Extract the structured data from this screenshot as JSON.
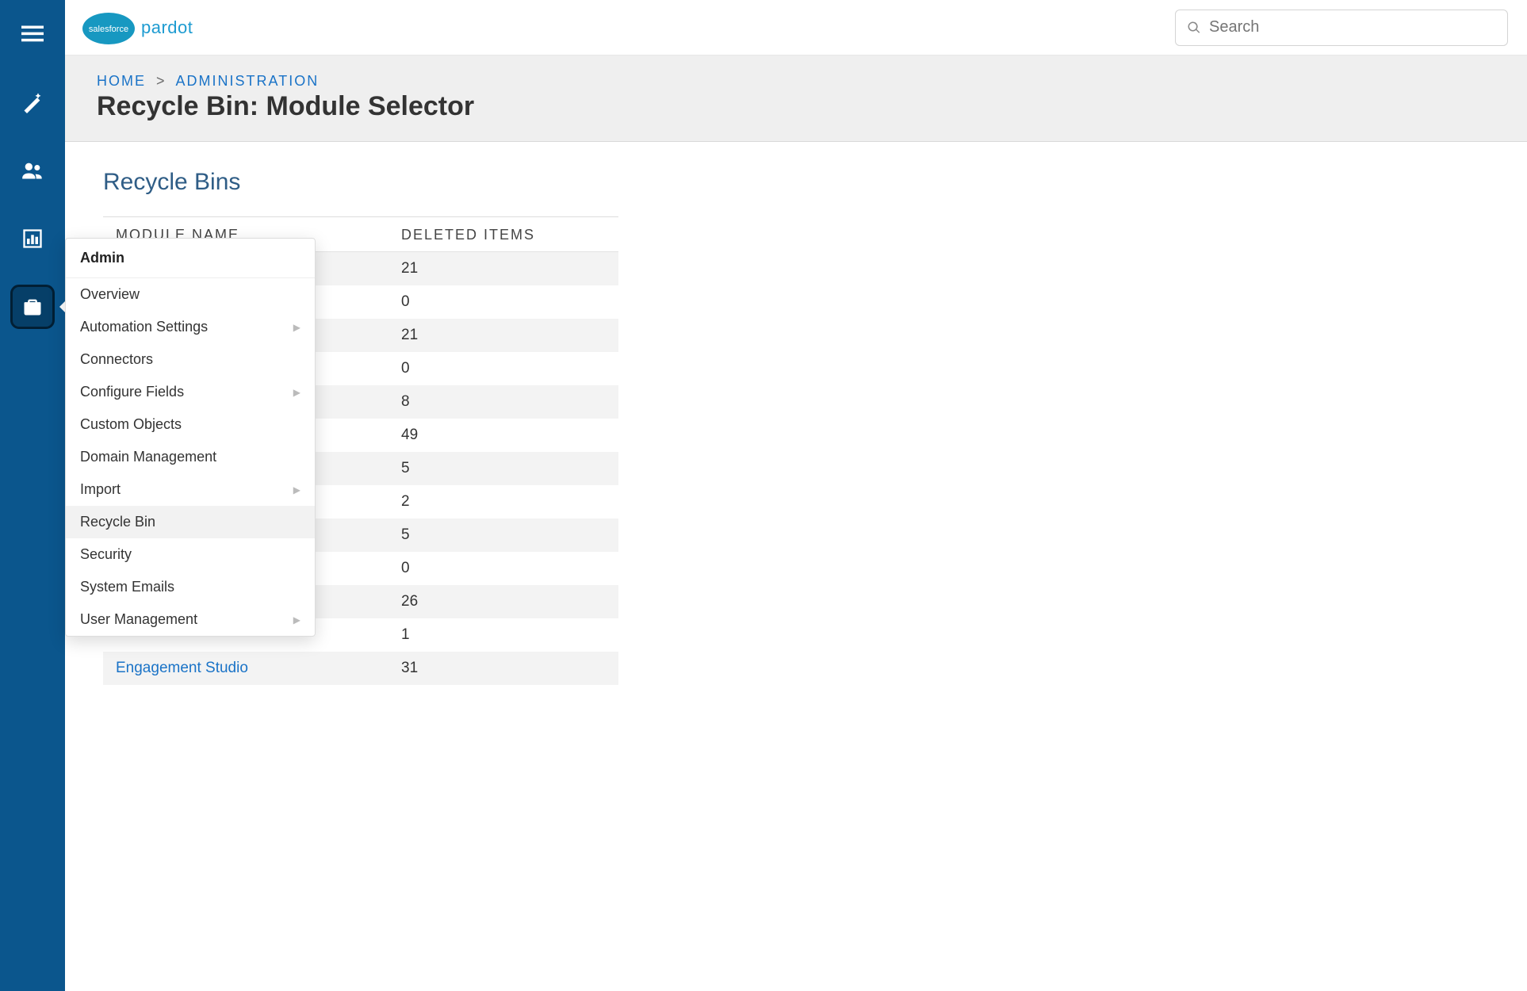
{
  "brand": {
    "name": "salesforce",
    "product": "pardot"
  },
  "search": {
    "placeholder": "Search"
  },
  "breadcrumb": {
    "home": "HOME",
    "admin": "ADMINISTRATION",
    "sep": ">"
  },
  "page_title": "Recycle Bin: Module Selector",
  "section_title": "Recycle Bins",
  "table": {
    "col_module": "MODULE NAME",
    "col_deleted": "DELETED ITEMS",
    "rows": [
      {
        "name": "",
        "count": "21"
      },
      {
        "name": "",
        "count": "0"
      },
      {
        "name": "",
        "count": "21"
      },
      {
        "name": "",
        "count": "0"
      },
      {
        "name": "",
        "count": "8"
      },
      {
        "name": "",
        "count": "49"
      },
      {
        "name": "",
        "count": "5"
      },
      {
        "name": "",
        "count": "2"
      },
      {
        "name": "",
        "count": "5"
      },
      {
        "name": "",
        "count": "0"
      },
      {
        "name": "",
        "count": "26"
      },
      {
        "name": "",
        "count": "1"
      },
      {
        "name": "Engagement Studio",
        "count": "31"
      }
    ]
  },
  "admin_menu": {
    "title": "Admin",
    "items": [
      {
        "label": "Overview",
        "hasSub": false
      },
      {
        "label": "Automation Settings",
        "hasSub": true
      },
      {
        "label": "Connectors",
        "hasSub": false
      },
      {
        "label": "Configure Fields",
        "hasSub": true
      },
      {
        "label": "Custom Objects",
        "hasSub": false
      },
      {
        "label": "Domain Management",
        "hasSub": false
      },
      {
        "label": "Import",
        "hasSub": true
      },
      {
        "label": "Recycle Bin",
        "hasSub": false,
        "selected": true
      },
      {
        "label": "Security",
        "hasSub": false
      },
      {
        "label": "System Emails",
        "hasSub": false
      },
      {
        "label": "User Management",
        "hasSub": true
      }
    ]
  }
}
